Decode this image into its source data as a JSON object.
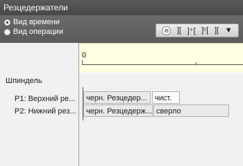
{
  "window": {
    "title": "Резцедержатели"
  },
  "view_options": [
    {
      "label": "Вид времени",
      "selected": true
    },
    {
      "label": "Вид операции",
      "selected": false
    }
  ],
  "toolbar": {
    "buttons": [
      "⊖",
      "][",
      "]⁺[",
      "]ᶜ[",
      "][",
      "▼"
    ]
  },
  "timeline": {
    "start": "0"
  },
  "tree": {
    "spindle": "Шпиндель",
    "rows": [
      {
        "label": "P1: Верхний ре...",
        "ops": [
          "черн. Резцедер...",
          "чист."
        ]
      },
      {
        "label": "P2: Нижний рез...",
        "ops": [
          "черн. Резцедерж...",
          "сверло"
        ]
      }
    ]
  }
}
